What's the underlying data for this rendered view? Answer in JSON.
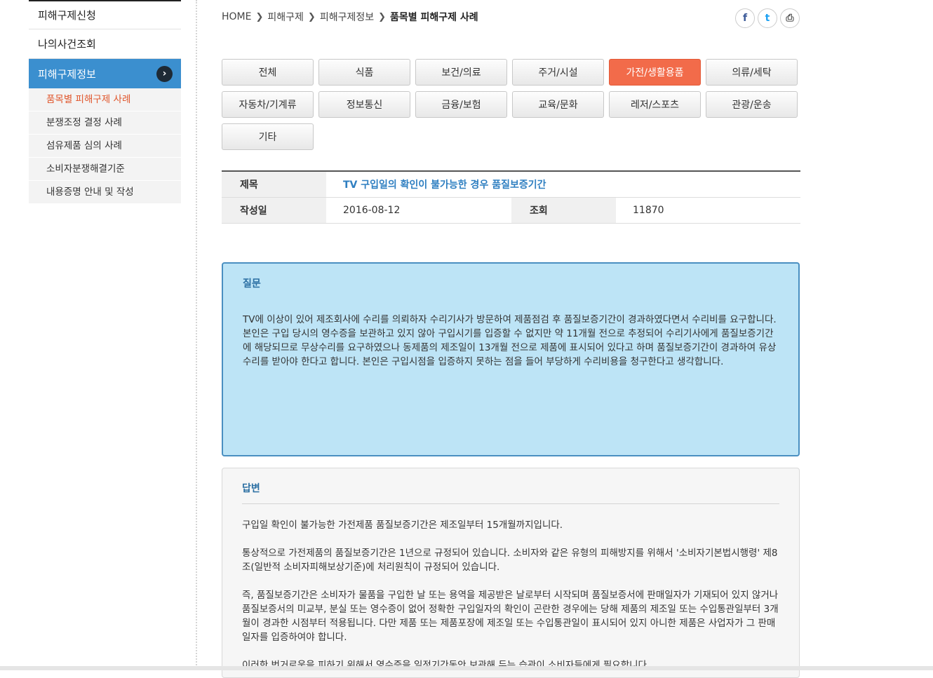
{
  "sidebar": {
    "items": [
      {
        "label": "피해구제신청"
      },
      {
        "label": "나의사건조회"
      }
    ],
    "active": {
      "label": "피해구제정보"
    },
    "sub_items": [
      {
        "label": "품목별 피해구제 사례"
      },
      {
        "label": "분쟁조정 결정 사례"
      },
      {
        "label": "섬유제품 심의 사례"
      },
      {
        "label": "소비자분쟁해결기준"
      },
      {
        "label": "내용증명 안내 및 작성"
      }
    ]
  },
  "breadcrumb": [
    "HOME",
    "피해구제",
    "피해구제정보",
    "품목별 피해구제 사례"
  ],
  "categories": [
    "전체",
    "식품",
    "보건/의료",
    "주거/시설",
    "가전/생활용품",
    "의류/세탁",
    "자동차/기계류",
    "정보통신",
    "금융/보험",
    "교육/문화",
    "레저/스포츠",
    "관광/운송",
    "기타"
  ],
  "active_category": "가전/생활용품",
  "article": {
    "title_label": "제목",
    "title": "TV 구입일의 확인이 불가능한 경우 품질보증기간",
    "date_label": "작성일",
    "date": "2016-08-12",
    "views_label": "조회",
    "views": "11870"
  },
  "question": {
    "heading": "질문",
    "text": "TV에 이상이 있어 제조회사에 수리를 의뢰하자 수리기사가 방문하여 제품점검 후 품질보증기간이 경과하였다면서 수리비를 요구합니다. 본인은 구입 당시의 영수증을 보관하고 있지 않아 구입시기를 입증할 수 없지만 약 11개월 전으로 추정되어 수리기사에게 품질보증기간에 해당되므로 무상수리를 요구하였으나 동제품의 제조일이 13개월 전으로 제품에 표시되어 있다고 하며 품질보증기간이 경과하여 유상수리를 받아야 한다고 합니다. 본인은 구입시점을 입증하지 못하는 점을 들어 부당하게 수리비용을 청구한다고 생각합니다."
  },
  "answer": {
    "heading": "답변",
    "paragraphs": [
      "구입일 확인이 불가능한 가전제품 품질보증기간은 제조일부터 15개월까지입니다.",
      "통상적으로 가전제품의 품질보증기간은 1년으로 규정되어 있습니다. 소비자와 같은 유형의 피해방지를 위해서 '소비자기본법시행령' 제8조(일반적 소비자피해보상기준)에 처리원칙이 규정되어 있습니다.",
      "즉, 품질보증기간은 소비자가 물품을 구입한 날 또는 용역을 제공받은 날로부터 시작되며 품질보증서에 판매일자가 기재되어 있지 않거나 품질보증서의 미교부, 분실 또는 영수증이 없어 정확한 구입일자의 확인이 곤란한 경우에는 당해 제품의 제조일 또는 수입통관일부터 3개월이 경과한 시점부터 적용됩니다. 다만 제품 또는 제품포장에 제조일 또는 수입통관일이 표시되어 있지 아니한 제품은 사업자가 그 판매일자를 입증하여야 합니다.",
      "이러한 번거로움을 피하기 위해서 영수증을 일정기간동안 보관해 두는 습관이 소비자들에게 필요합니다."
    ]
  },
  "share": {
    "facebook_glyph": "f",
    "twitter_glyph": "t",
    "print_glyph": "⎙"
  }
}
